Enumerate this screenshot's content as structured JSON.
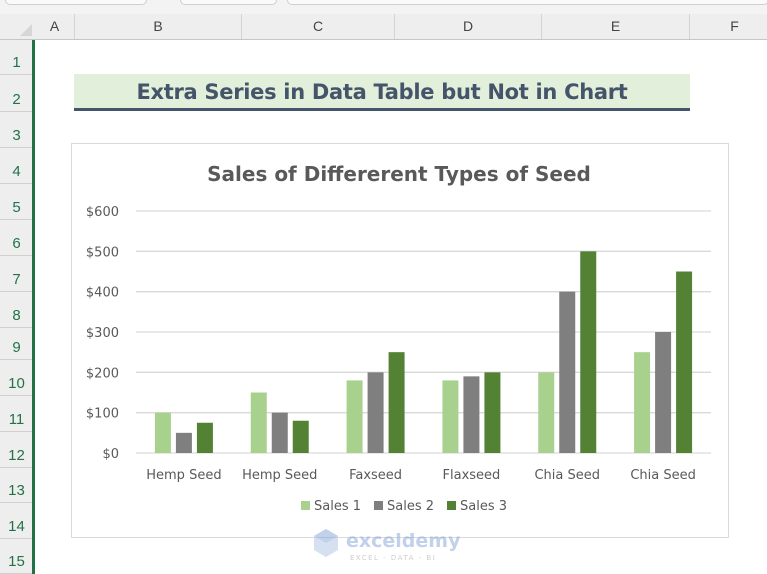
{
  "spreadsheet": {
    "columns": [
      "A",
      "B",
      "C",
      "D",
      "E",
      "F"
    ],
    "rows": [
      "1",
      "2",
      "3",
      "4",
      "5",
      "6",
      "7",
      "8",
      "9",
      "10",
      "11",
      "12",
      "13",
      "14",
      "15"
    ]
  },
  "banner": {
    "title": "Extra Series in Data Table but Not in Chart",
    "background": "#e2efda",
    "text_color": "#44546a"
  },
  "watermark": {
    "brand": "exceldemy",
    "tagline": "EXCEL - DATA - BI"
  },
  "chart_data": {
    "type": "bar",
    "title": "Sales of Differerent Types of Seed",
    "xlabel": "",
    "ylabel": "",
    "categories": [
      "Hemp Seed",
      "Hemp Seed",
      "Faxseed",
      "Flaxseed",
      "Chia Seed",
      "Chia Seed"
    ],
    "series": [
      {
        "name": "Sales 1",
        "color": "#a9d18e",
        "values": [
          100,
          150,
          180,
          180,
          200,
          250
        ]
      },
      {
        "name": "Sales 2",
        "color": "#7f7f7f",
        "values": [
          50,
          100,
          200,
          190,
          400,
          300
        ]
      },
      {
        "name": "Sales 3",
        "color": "#548235",
        "values": [
          75,
          80,
          250,
          200,
          500,
          450
        ]
      }
    ],
    "ylim": [
      0,
      600
    ],
    "yticks": [
      0,
      100,
      200,
      300,
      400,
      500,
      600
    ],
    "ytick_labels": [
      "$0",
      "$100",
      "$200",
      "$300",
      "$400",
      "$500",
      "$600"
    ],
    "grid": true,
    "legend_position": "bottom"
  }
}
